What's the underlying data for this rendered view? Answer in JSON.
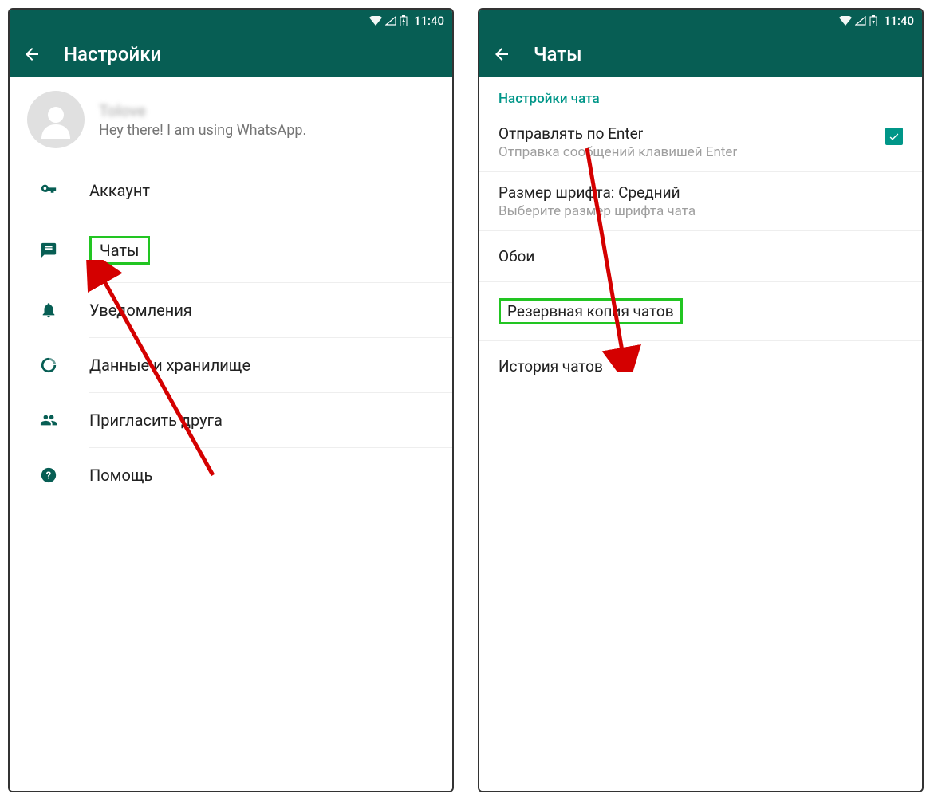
{
  "status": {
    "time": "11:40"
  },
  "left": {
    "title": "Настройки",
    "profile_name": "Tolove",
    "profile_status": "Hey there! I am using WhatsApp.",
    "menu": {
      "account": "Аккаунт",
      "chats": "Чаты",
      "notifications": "Уведомления",
      "data": "Данные и хранилище",
      "invite": "Пригласить друга",
      "help": "Помощь"
    }
  },
  "right": {
    "title": "Чаты",
    "section": "Настройки чата",
    "enter": {
      "title": "Отправлять по Enter",
      "sub": "Отправка сообщений клавишей Enter"
    },
    "font": {
      "title": "Размер шрифта: Средний",
      "sub": "Выберите размер шрифта чата"
    },
    "wallpaper": "Обои",
    "backup": "Резервная копия чатов",
    "history": "История чатов"
  }
}
